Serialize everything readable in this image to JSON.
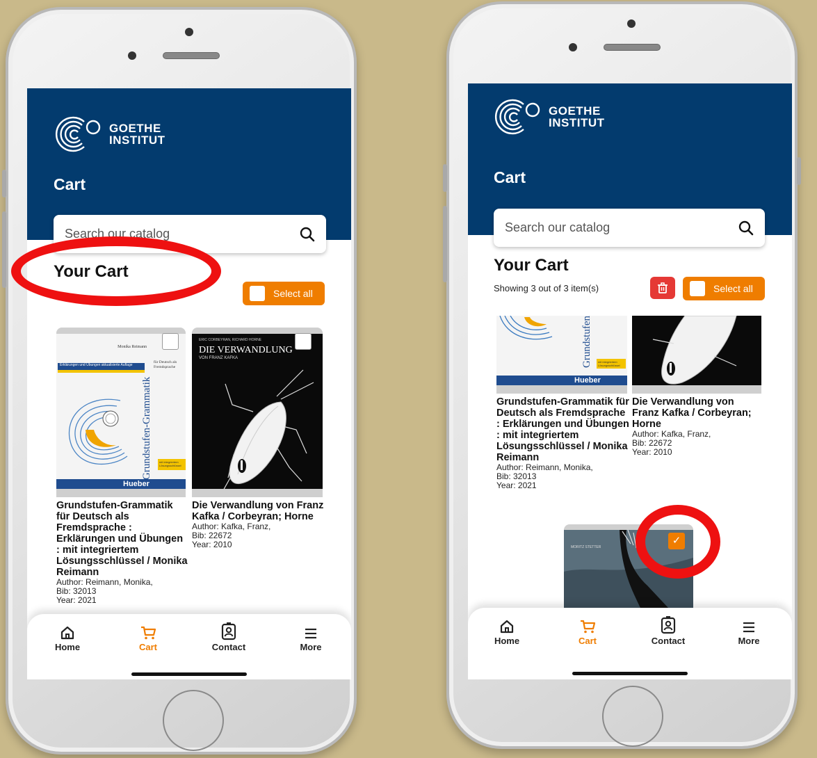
{
  "app": {
    "logo_line1": "GOETHE",
    "logo_line2": "INSTITUT",
    "page_title": "Cart",
    "search_placeholder": "Search our catalog",
    "cart_heading": "Your Cart",
    "select_all_label": "Select all",
    "showing_text": "Showing 3 out of 3 item(s)"
  },
  "books": [
    {
      "title": "Grundstufen-Grammatik für Deutsch als Fremdsprache : Erklärungen und Übungen : mit integriertem Lösungsschlüssel / Monika Reimann",
      "author": "Author: Reimann, Monika,",
      "bib": "Bib: 32013",
      "year": "Year: 2021",
      "cover_spine": "Grundstufen-Grammatik",
      "cover_author": "Monika Reimann",
      "cover_sub": "für Deutsch als Fremdsprache",
      "cover_band": "Erklärungen und Übungen aktualisierte Auflage",
      "cover_publisher": "Hueber",
      "cover_sticker": "mit integriertem Lösungsschlüssel"
    },
    {
      "title": "Die Verwandlung von Franz Kafka / Corbeyran; Horne",
      "author": "Author: Kafka, Franz,",
      "bib": "Bib: 22672",
      "year": "Year: 2010",
      "cover_top": "ERIC CORBEYRAN, RICHARD HORNE",
      "cover_title": "DIE VERWANDLUNG",
      "cover_sub": "VON FRANZ KAFKA"
    },
    {
      "cover_text": "MORITZ STETTER"
    }
  ],
  "nav": {
    "home": "Home",
    "cart": "Cart",
    "contact": "Contact",
    "more": "More"
  },
  "colors": {
    "brand_blue": "#033b6e",
    "accent_orange": "#ef7d00",
    "highlight_red": "#ee1111",
    "delete_red": "#e53935"
  },
  "state": {
    "left_phone_third_item_selected": false,
    "right_phone_third_item_selected": true
  }
}
